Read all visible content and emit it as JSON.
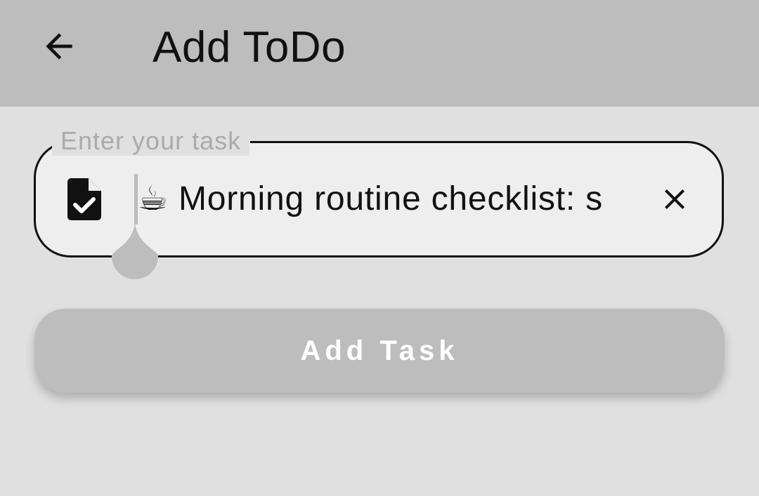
{
  "app_bar": {
    "back_icon": "arrow-back-icon",
    "title": "Add ToDo"
  },
  "task_field": {
    "label": "Enter your task",
    "leading_icon": "file-check-icon",
    "value": "☕ Morning routine checklist: s",
    "clear_icon": "close-icon"
  },
  "add_button": {
    "label": "Add Task"
  },
  "colors": {
    "app_bar": "#bdbdbd",
    "background": "#e0e0e0",
    "field_background": "#eeeeee",
    "button": "#bdbdbd"
  }
}
